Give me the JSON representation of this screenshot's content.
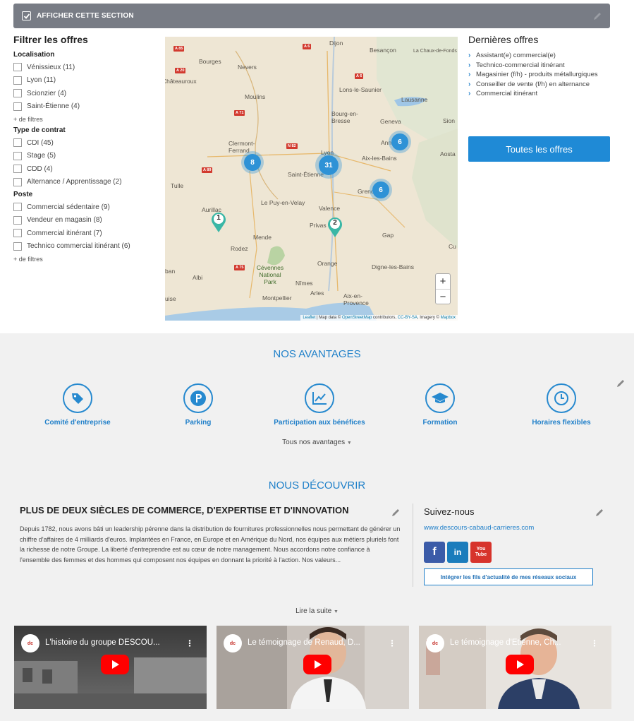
{
  "section_bar": {
    "label": "AFFICHER CETTE SECTION"
  },
  "filters": {
    "title": "Filtrer les offres",
    "groups": [
      {
        "label": "Localisation",
        "options": [
          "Vénissieux (11)",
          "Lyon (11)",
          "Scionzier (4)",
          "Saint-Étienne (4)"
        ],
        "more": "+ de filtres"
      },
      {
        "label": "Type de contrat",
        "options": [
          "CDI (45)",
          "Stage (5)",
          "CDD (4)",
          "Alternance / Apprentissage (2)"
        ]
      },
      {
        "label": "Poste",
        "options": [
          "Commercial sédentaire (9)",
          "Vendeur en magasin (8)",
          "Commercial itinérant (7)",
          "Technico commercial itinérant (6)"
        ],
        "more": "+ de filtres"
      }
    ]
  },
  "map": {
    "cities": [
      "Dijon",
      "Besançon",
      "La Chaux-de-Fonds",
      "Bourges",
      "Nevers",
      "Châteauroux",
      "Lons-le-Saunier",
      "Moulins",
      "Lausanne",
      "Bourg-en-Bresse",
      "Geneva",
      "Sion",
      "Clermont-Ferrand",
      "Lyon",
      "Annecy",
      "Aix-les-Bains",
      "Aosta",
      "Saint-Étienne",
      "Tulle",
      "Grenoble",
      "Le Puy-en-Velay",
      "Aurillac",
      "Valence",
      "Privas",
      "Mende",
      "Gap",
      "Rodez",
      "Orange",
      "Digne-les-Bains",
      "Albi",
      "Cévennes National Park",
      "Nîmes",
      "Montpellier",
      "Arles",
      "Aix-en-Provence",
      "ban",
      "uise",
      "Cu"
    ],
    "roads": [
      "A 85",
      "A 6",
      "A 20",
      "A 71",
      "A 89",
      "N 82",
      "A 75"
    ],
    "clusters": [
      "8",
      "31",
      "6",
      "6"
    ],
    "pins": [
      "1",
      "2"
    ],
    "zoom_in": "+",
    "zoom_out": "−",
    "attribution_links": [
      "Leaflet",
      "OpenStreetMap",
      "CC-BY-SA",
      "Mapbox"
    ],
    "attribution_texts": [
      " | Map data © ",
      " contributors, ",
      ", Imagery © "
    ]
  },
  "latest": {
    "title": "Dernières offres",
    "items": [
      "Assistant(e) commercial(e)",
      "Technico-commercial itinérant",
      "Magasinier (f/h) - produits métallurgiques",
      "Conseiller de vente (f/h) en alternance",
      "Commercial itinérant"
    ],
    "button": "Toutes les offres"
  },
  "advantages": {
    "title": "NOS AVANTAGES",
    "items": [
      "Comité d'entreprise",
      "Parking",
      "Participation aux bénéfices",
      "Formation",
      "Horaires flexibles"
    ],
    "all_label": "Tous nos avantages"
  },
  "discover": {
    "title": "NOUS DÉCOUVRIR",
    "heading": "PLUS DE DEUX SIÈCLES DE COMMERCE, D'EXPERTISE ET D'INNOVATION",
    "body": "Depuis 1782, nous avons bâti un leadership pérenne dans la distribution de fournitures professionnelles nous permettant de générer un chiffre d'affaires de 4 milliards d'euros. Implantées en France, en Europe et en Amérique du Nord, nos équipes aux métiers pluriels font la richesse de notre Groupe. La liberté d'entreprendre est au cœur de notre management. Nous accordons notre confiance à l'ensemble des femmes et des hommes qui composent nos équipes en donnant la priorité à l'action. Nos valeurs...",
    "read_more": "Lire la suite"
  },
  "follow": {
    "title": "Suivez-nous",
    "url": "www.descours-cabaud-carrieres.com",
    "social": [
      "f",
      "in",
      "You Tube"
    ],
    "feed_button": "Intégrer les fils d'actualité de mes réseaux sociaux"
  },
  "videos": [
    {
      "title": "L'histoire du groupe DESCOU...",
      "logo": "dc"
    },
    {
      "title": "Le témoignage de Renaud, D...",
      "logo": "dc"
    },
    {
      "title": "Le témoignage d'Etienne, Ch...",
      "logo": "dc"
    }
  ],
  "colors": {
    "accent": "#1f80c9",
    "bar": "#787c85",
    "band": "#f1f1f1",
    "youtube": "#ff0000"
  }
}
